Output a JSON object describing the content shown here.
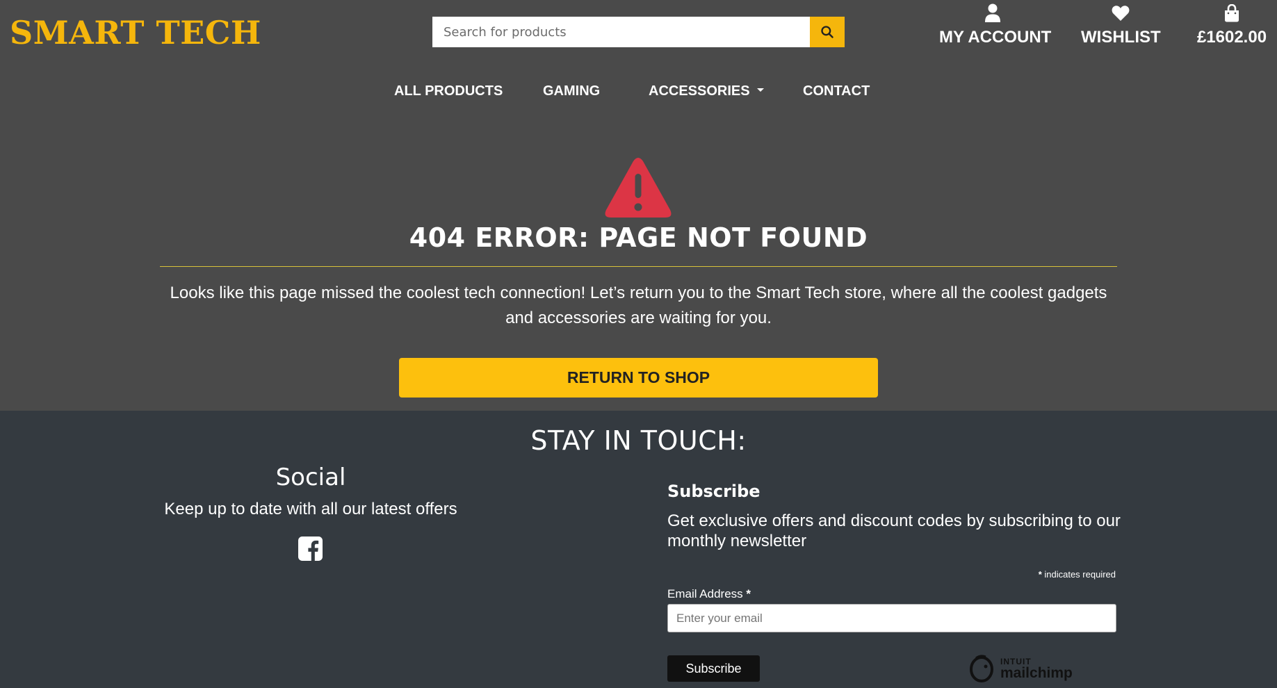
{
  "brand": {
    "name": "SMART TECH"
  },
  "search": {
    "placeholder": "Search for products"
  },
  "account": {
    "my_account": "MY ACCOUNT",
    "wishlist": "WISHLIST",
    "basket_total": "£1602.00"
  },
  "nav": {
    "items": [
      "ALL PRODUCTS",
      "GAMING",
      "ACCESSORIES",
      "CONTACT"
    ]
  },
  "error": {
    "title": "404 ERROR: PAGE NOT FOUND",
    "line1": "Looks like this page missed the coolest tech connection! Let’s return you to the Smart Tech store, where all the coolest gadgets",
    "line2": "and accessories are waiting for you.",
    "button": "RETURN TO SHOP"
  },
  "footer": {
    "heading": "STAY IN TOUCH:",
    "social_title": "Social",
    "social_text": "Keep up to date with all our latest offers",
    "subscribe_title": "Subscribe",
    "subscribe_text": "Get exclusive offers and discount codes by subscribing to our monthly newsletter",
    "required_note": "indicates required",
    "asterisk": "*",
    "email_label": "Email Address",
    "email_placeholder": "Enter your email",
    "subscribe_button": "Subscribe",
    "mailchimp_line1": "INTUIT",
    "mailchimp_line2": "mailchimp"
  },
  "colors": {
    "accent": "#fdc00d",
    "brand": "#f5b60c",
    "warning": "#dc3545",
    "header_bg": "#4a4a4a",
    "footer_bg": "#343a40"
  },
  "icons": {
    "search": "search-icon",
    "account": "user-icon",
    "wishlist": "heart-icon",
    "basket": "shopping-bag-icon",
    "error": "warning-triangle-icon",
    "facebook": "facebook-icon"
  }
}
